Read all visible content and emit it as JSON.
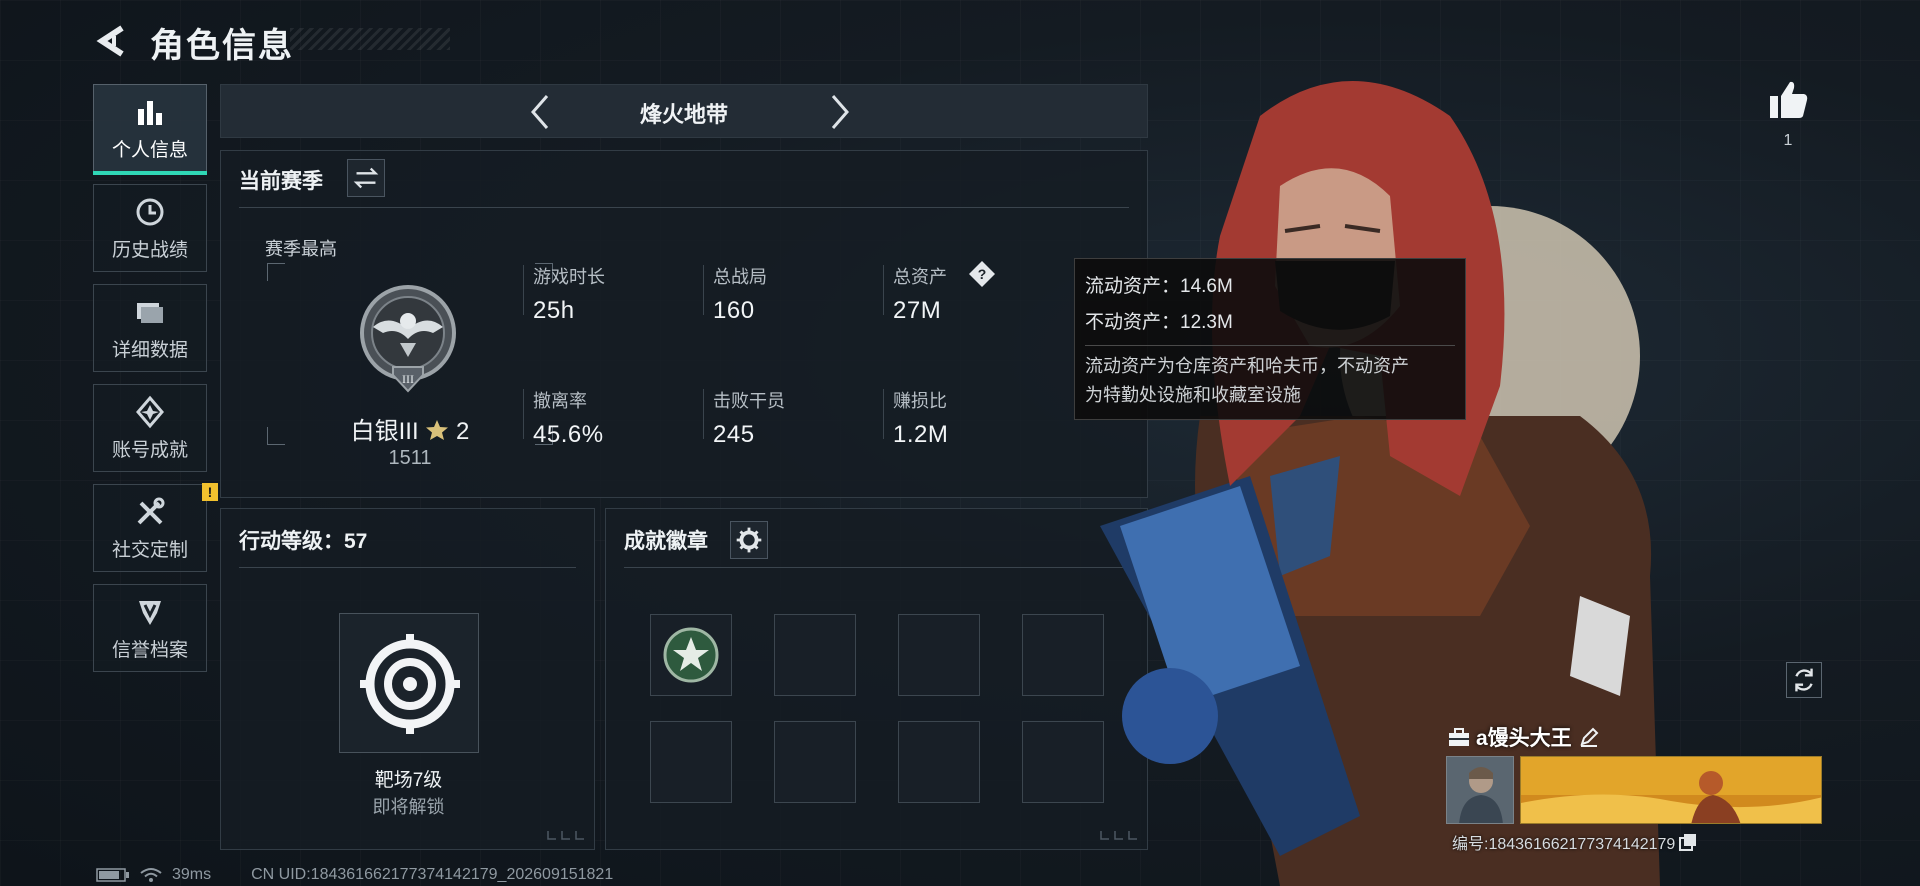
{
  "header": {
    "title": "角色信息"
  },
  "sidebar": {
    "items": [
      {
        "label": "个人信息",
        "icon": "bar-chart-icon",
        "active": true
      },
      {
        "label": "历史战绩",
        "icon": "clock-icon"
      },
      {
        "label": "详细数据",
        "icon": "folder-icon"
      },
      {
        "label": "账号成就",
        "icon": "medal-icon"
      },
      {
        "label": "社交定制",
        "icon": "tools-icon",
        "badge": "!"
      },
      {
        "label": "信誉档案",
        "icon": "shield-icon"
      }
    ]
  },
  "mode": {
    "title": "烽火地带"
  },
  "season": {
    "heading": "当前赛季",
    "best_label": "赛季最高",
    "rank_name": "白银III",
    "rank_stars": "2",
    "rank_score": "1511",
    "stats": [
      {
        "label": "游戏时长",
        "value": "25h"
      },
      {
        "label": "总战局",
        "value": "160"
      },
      {
        "label": "总资产",
        "value": "27M"
      },
      {
        "label": "撤离率",
        "value": "45.6%"
      },
      {
        "label": "击败干员",
        "value": "245"
      },
      {
        "label": "赚损比",
        "value": "1.2M"
      }
    ]
  },
  "tooltip": {
    "liquid": "流动资产：14.6M",
    "fixed": "不动资产：12.3M",
    "desc_1": "流动资产为仓库资产和哈夫币，不动资产",
    "desc_2": "为特勤处设施和收藏室设施"
  },
  "level": {
    "heading": "行动等级：57",
    "target_name": "靶场7级",
    "target_status": "即将解锁"
  },
  "badges": {
    "heading": "成就徽章",
    "slot_count": 8,
    "filled": 1
  },
  "profile": {
    "like_count": "1",
    "player_name": "a馒头大王",
    "player_id": "编号:184361662177374142179"
  },
  "footer": {
    "ping": "39ms",
    "uid": "CN UID:184361662177374142179_202609151821"
  },
  "colors": {
    "accent": "#2fd6b5",
    "warning": "#f2c12e",
    "panel": "#151c23"
  }
}
